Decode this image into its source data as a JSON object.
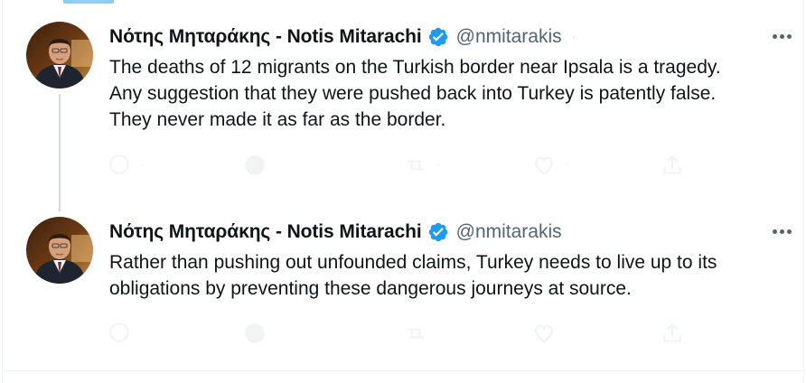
{
  "thread": {
    "tweets": [
      {
        "author_name": "Νότης Μηταράκης - Notis Mitarachi",
        "handle": "@nmitarakis",
        "text_lines": [
          "The deaths of 12 migrants on the Turkish border near Ipsala is a tragedy.",
          "Any suggestion that they were pushed back into Turkey is patently false.",
          "They never made it as far as the border."
        ],
        "verified": true
      },
      {
        "author_name": "Νότης Μηταράκης - Notis Mitarachi",
        "handle": "@nmitarakis",
        "text_lines": [
          "Rather than pushing out unfounded claims, Turkey needs to live up to its",
          "obligations by preventing these dangerous journeys at source."
        ],
        "verified": true
      }
    ]
  },
  "colors": {
    "verified_badge": "#1d9bf0",
    "text": "#0f1419",
    "secondary_text": "#536471",
    "thread_line": "#cfd9de"
  },
  "icons": [
    "verified-badge-icon",
    "more-icon",
    "reply-icon",
    "chart-icon",
    "retweet-icon",
    "like-icon",
    "share-icon"
  ]
}
